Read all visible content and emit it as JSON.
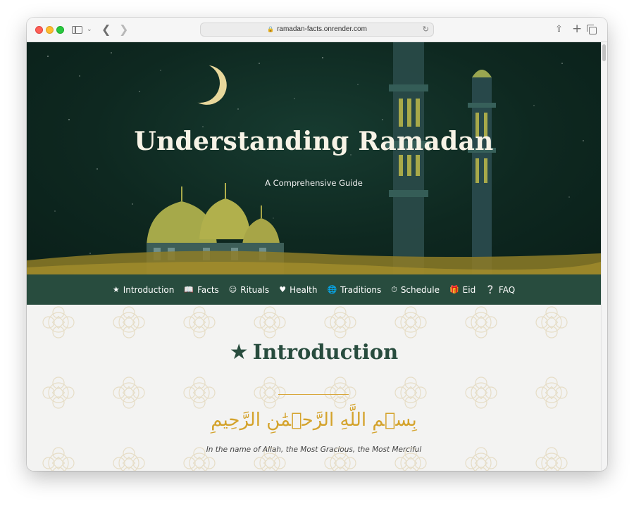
{
  "browser": {
    "url": "ramadan-facts.onrender.com",
    "icons": {
      "sidebar": "sidebar-icon",
      "back": "back-icon",
      "forward": "forward-icon",
      "lock": "lock-icon",
      "reload": "reload-icon",
      "share": "share-icon",
      "new_tab": "plus-icon",
      "tabs": "tabs-overview-icon"
    }
  },
  "hero": {
    "title": "Understanding Ramadan",
    "subtitle": "A Comprehensive Guide"
  },
  "nav": {
    "items": [
      {
        "label": "Introduction",
        "icon": "star-icon"
      },
      {
        "label": "Facts",
        "icon": "book-icon"
      },
      {
        "label": "Rituals",
        "icon": "pray-icon"
      },
      {
        "label": "Health",
        "icon": "heartbeat-icon"
      },
      {
        "label": "Traditions",
        "icon": "globe-icon"
      },
      {
        "label": "Schedule",
        "icon": "clock-icon"
      },
      {
        "label": "Eid",
        "icon": "gift-icon"
      },
      {
        "label": "FAQ",
        "icon": "question-icon"
      }
    ]
  },
  "intro": {
    "title": "Introduction",
    "arabic": "بِسۡمِ اللَّهِ الرَّحۡمَٰنِ الرَّحِيمِ",
    "translation": "In the name of Allah, the Most Gracious, the Most Merciful"
  },
  "colors": {
    "primary_green": "#284c3e",
    "gold": "#d4a32c",
    "hero_dark": "#0e2820",
    "background": "#f3f3f2"
  }
}
